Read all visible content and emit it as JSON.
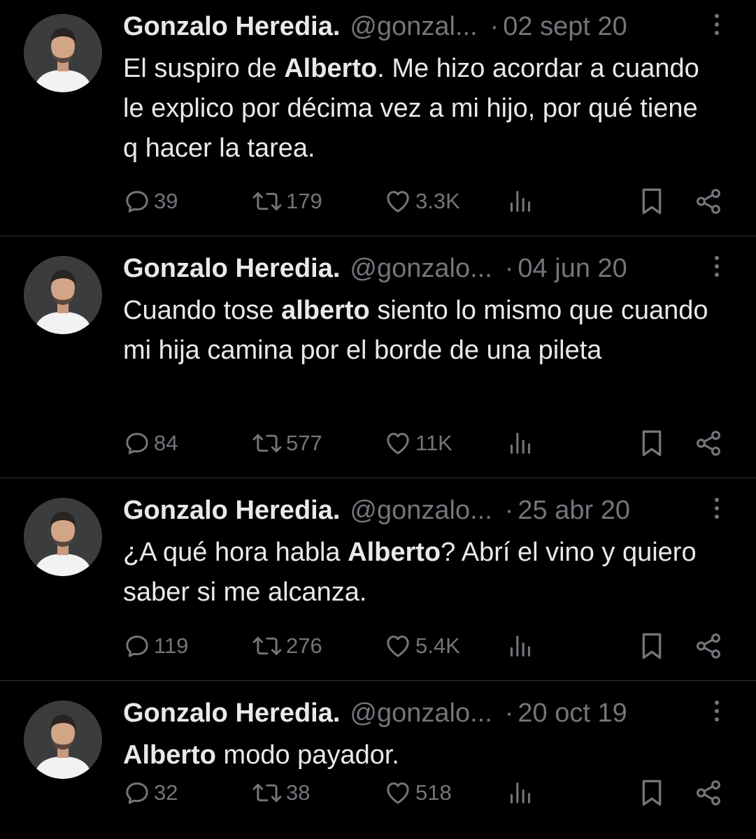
{
  "tweets": [
    {
      "name": "Gonzalo Heredia.",
      "handle": "@gonzal...",
      "dot": "·",
      "date": "02 sept 20",
      "text": [
        {
          "t": "El suspiro de ",
          "b": false
        },
        {
          "t": "Alberto",
          "b": true
        },
        {
          "t": ". Me hizo acordar a cuando le explico por décima vez a mi hijo, por qué tiene q hacer la tarea.",
          "b": false
        }
      ],
      "replies": "39",
      "retweets": "179",
      "likes": "3.3K"
    },
    {
      "name": "Gonzalo Heredia.",
      "handle": "@gonzalo...",
      "dot": "·",
      "date": "04 jun 20",
      "text": [
        {
          "t": "Cuando tose ",
          "b": false
        },
        {
          "t": "alberto",
          "b": true
        },
        {
          "t": " siento lo mismo que cuando mi hija camina por el borde de una pileta",
          "b": false
        }
      ],
      "replies": "84",
      "retweets": "577",
      "likes": "11K"
    },
    {
      "name": "Gonzalo Heredia.",
      "handle": "@gonzalo...",
      "dot": "·",
      "date": "25 abr 20",
      "text": [
        {
          "t": "¿A qué hora habla ",
          "b": false
        },
        {
          "t": "Alberto",
          "b": true
        },
        {
          "t": "? Abrí el vino y quiero saber si me alcanza.",
          "b": false
        }
      ],
      "replies": "119",
      "retweets": "276",
      "likes": "5.4K"
    },
    {
      "name": "Gonzalo Heredia.",
      "handle": "@gonzalo...",
      "dot": "·",
      "date": "20 oct 19",
      "text": [
        {
          "t": "Alberto",
          "b": true
        },
        {
          "t": " modo payador.",
          "b": false
        }
      ],
      "replies": "32",
      "retweets": "38",
      "likes": "518"
    }
  ],
  "colors": {
    "background": "#000000",
    "text": "#e7e9ea",
    "muted": "#71767b",
    "divider": "#2f3336"
  },
  "icons": [
    "avatar",
    "more-icon",
    "reply-icon",
    "retweet-icon",
    "like-icon",
    "views-icon",
    "bookmark-icon",
    "share-icon"
  ]
}
